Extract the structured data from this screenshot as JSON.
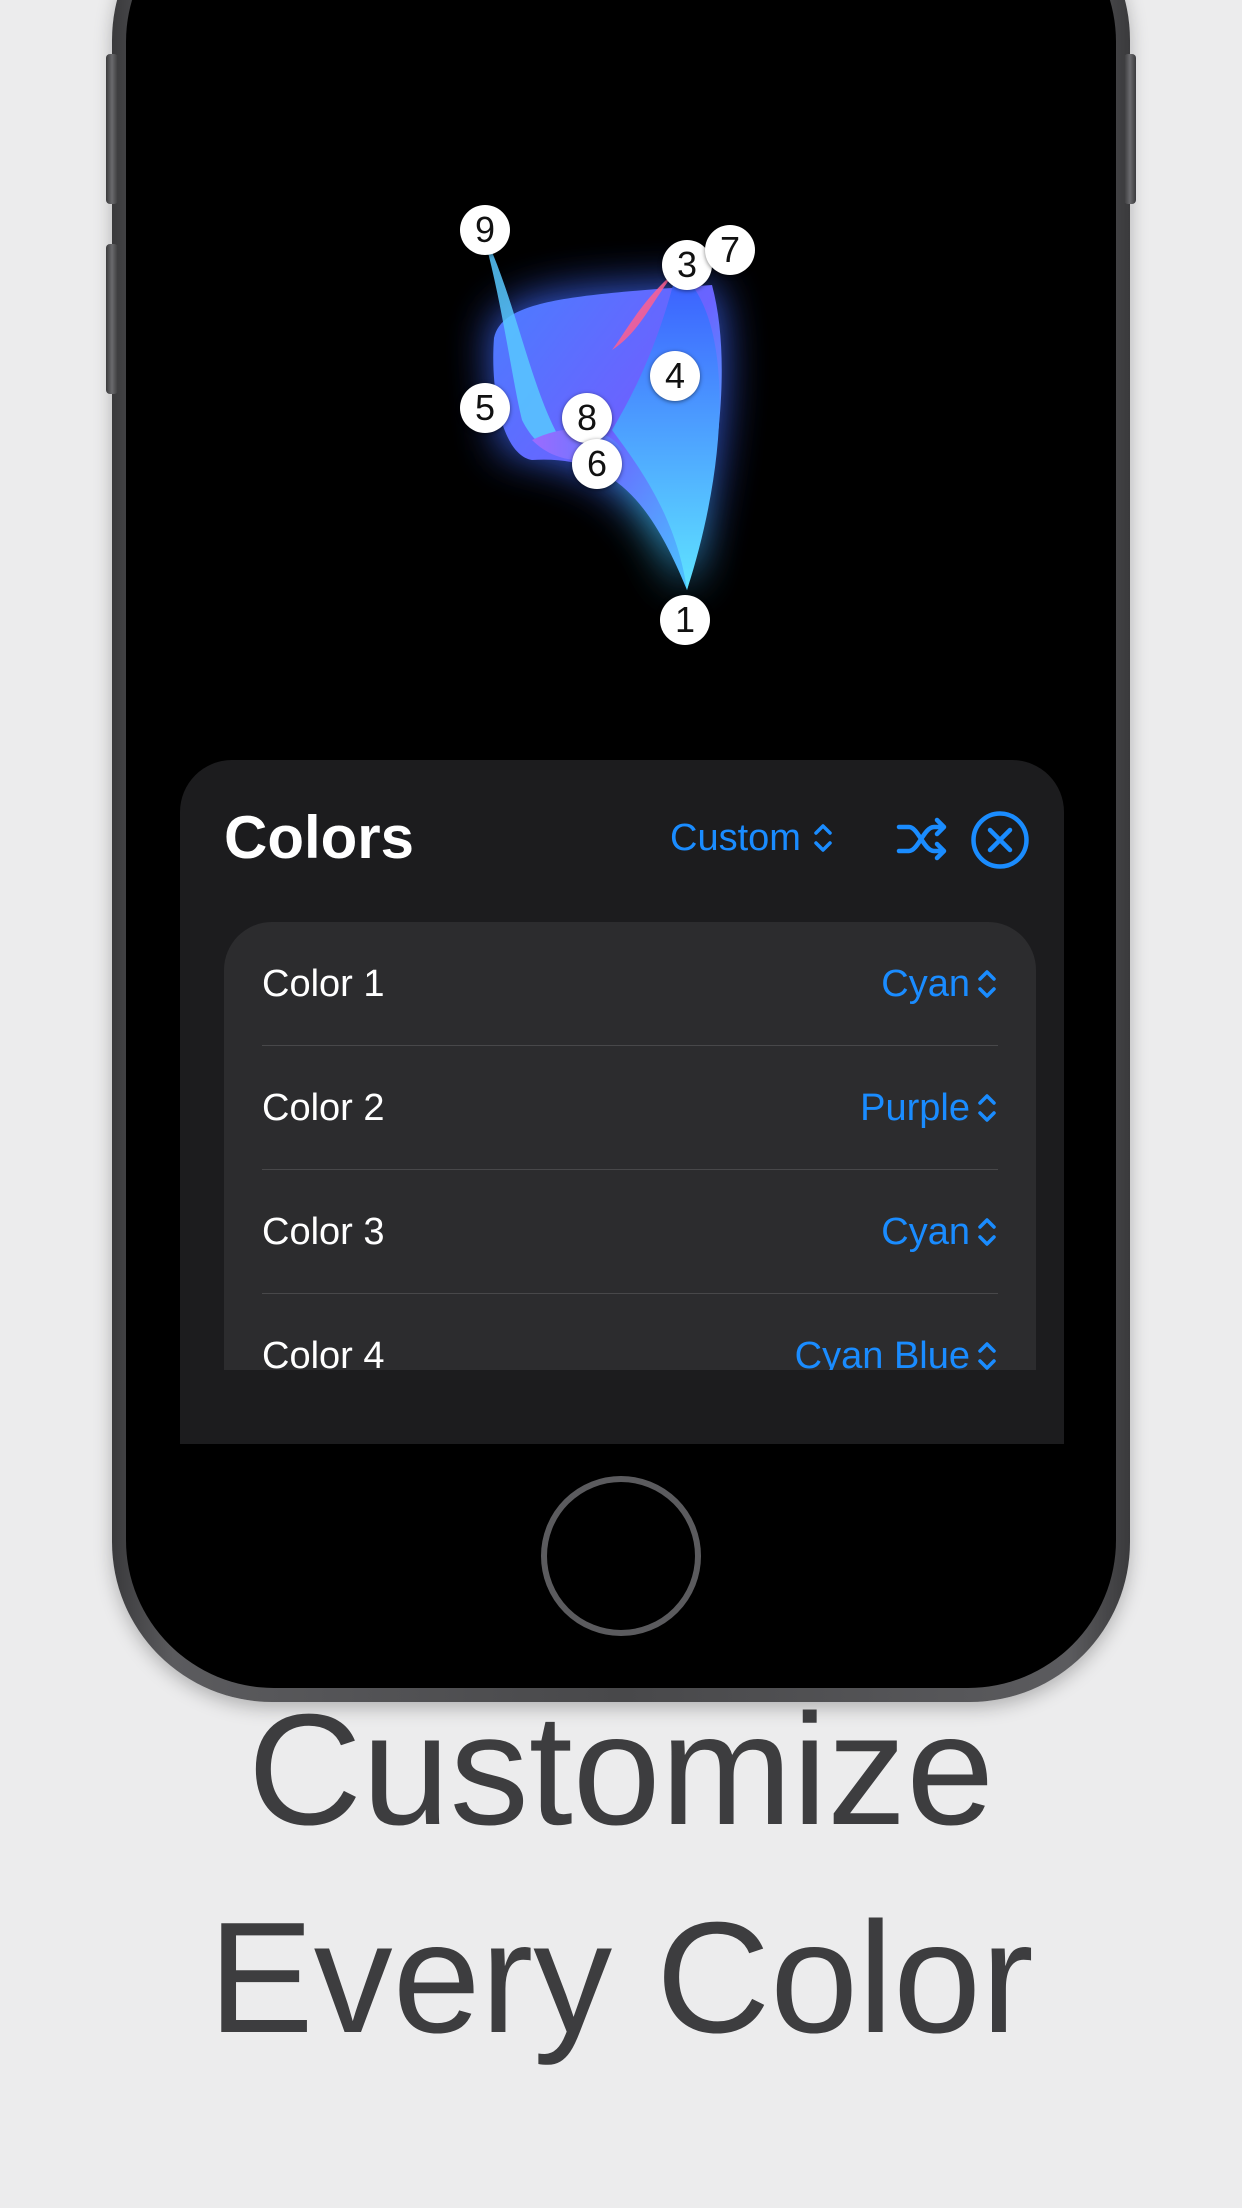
{
  "colors": {
    "accent": "#1a8cff",
    "sheet_bg": "#1c1c1e",
    "list_bg": "#2c2c2e",
    "caption": "#3d3d3f"
  },
  "preview": {
    "points": [
      {
        "label": "1"
      },
      {
        "label": "3"
      },
      {
        "label": "7"
      },
      {
        "label": "4"
      },
      {
        "label": "5"
      },
      {
        "label": "8"
      },
      {
        "label": "6"
      },
      {
        "label": "9"
      }
    ]
  },
  "sheet": {
    "title": "Colors",
    "preset_label": "Custom",
    "shuffle_icon": "shuffle-icon",
    "close_icon": "close-circle-icon",
    "rows": [
      {
        "label": "Color 1",
        "value": "Cyan"
      },
      {
        "label": "Color 2",
        "value": "Purple"
      },
      {
        "label": "Color 3",
        "value": "Cyan"
      },
      {
        "label": "Color 4",
        "value": "Cyan Blue"
      }
    ]
  },
  "caption": {
    "line1": "Customize",
    "line2": "Every Color"
  }
}
